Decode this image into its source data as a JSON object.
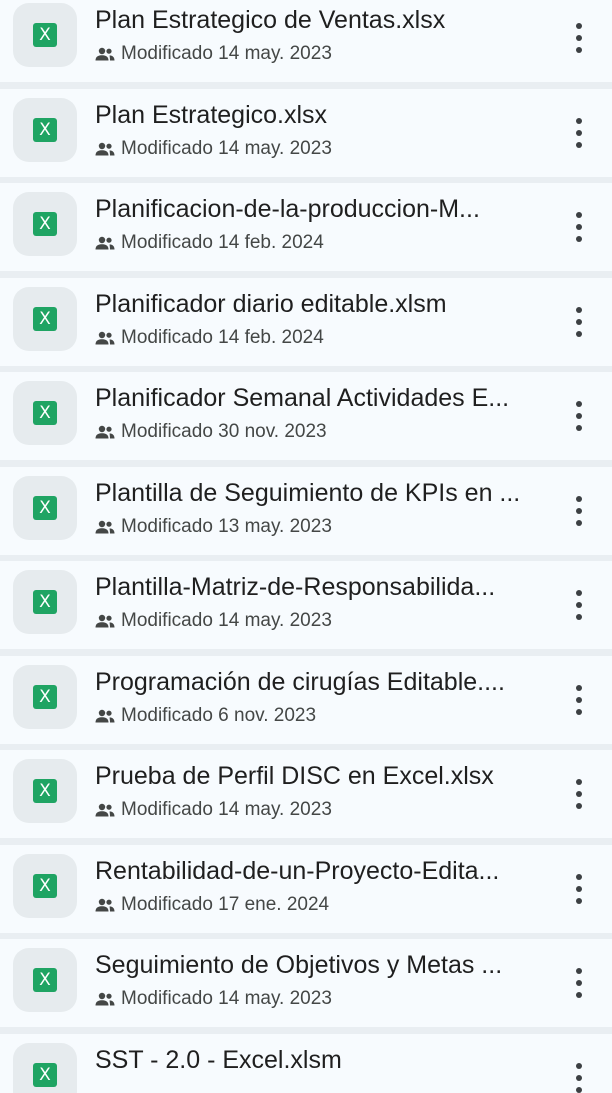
{
  "files": [
    {
      "name": "Plan Estrategico de Ventas.xlsx",
      "meta": "Modificado 14 may. 2023",
      "file_icon": "excel-icon",
      "file_icon_letter": "X",
      "shared_icon": "people-icon",
      "more_icon": "more-vert-icon"
    },
    {
      "name": "Plan Estrategico.xlsx",
      "meta": "Modificado 14 may. 2023",
      "file_icon": "excel-icon",
      "file_icon_letter": "X",
      "shared_icon": "people-icon",
      "more_icon": "more-vert-icon"
    },
    {
      "name": "Planificacion-de-la-produccion-M...",
      "meta": "Modificado 14 feb. 2024",
      "file_icon": "excel-icon",
      "file_icon_letter": "X",
      "shared_icon": "people-icon",
      "more_icon": "more-vert-icon"
    },
    {
      "name": "Planificador diario editable.xlsm",
      "meta": "Modificado 14 feb. 2024",
      "file_icon": "excel-icon",
      "file_icon_letter": "X",
      "shared_icon": "people-icon",
      "more_icon": "more-vert-icon"
    },
    {
      "name": "Planificador Semanal Actividades E...",
      "meta": "Modificado 30 nov. 2023",
      "file_icon": "excel-icon",
      "file_icon_letter": "X",
      "shared_icon": "people-icon",
      "more_icon": "more-vert-icon"
    },
    {
      "name": "Plantilla de Seguimiento de KPIs en ...",
      "meta": "Modificado 13 may. 2023",
      "file_icon": "excel-icon",
      "file_icon_letter": "X",
      "shared_icon": "people-icon",
      "more_icon": "more-vert-icon"
    },
    {
      "name": "Plantilla-Matriz-de-Responsabilida...",
      "meta": "Modificado 14 may. 2023",
      "file_icon": "excel-icon",
      "file_icon_letter": "X",
      "shared_icon": "people-icon",
      "more_icon": "more-vert-icon"
    },
    {
      "name": "Programación de cirugías Editable....",
      "meta": "Modificado 6 nov. 2023",
      "file_icon": "excel-icon",
      "file_icon_letter": "X",
      "shared_icon": "people-icon",
      "more_icon": "more-vert-icon"
    },
    {
      "name": "Prueba de Perfil DISC en Excel.xlsx",
      "meta": "Modificado 14 may. 2023",
      "file_icon": "excel-icon",
      "file_icon_letter": "X",
      "shared_icon": "people-icon",
      "more_icon": "more-vert-icon"
    },
    {
      "name": "Rentabilidad-de-un-Proyecto-Edita...",
      "meta": "Modificado 17 ene. 2024",
      "file_icon": "excel-icon",
      "file_icon_letter": "X",
      "shared_icon": "people-icon",
      "more_icon": "more-vert-icon"
    },
    {
      "name": "Seguimiento de Objetivos y Metas ...",
      "meta": "Modificado 14 may. 2023",
      "file_icon": "excel-icon",
      "file_icon_letter": "X",
      "shared_icon": "people-icon",
      "more_icon": "more-vert-icon"
    },
    {
      "name": "SST - 2.0 - Excel.xlsm",
      "meta": "",
      "file_icon": "excel-icon",
      "file_icon_letter": "X",
      "shared_icon": "",
      "more_icon": "more-vert-icon"
    }
  ],
  "colors": {
    "row_background": "#f7fbfe",
    "divider": "#e9eef2",
    "thumbnail_background": "#e6ebee",
    "excel_green": "#1fa463",
    "title_text": "#1f1f1f",
    "meta_text": "#444746",
    "icon": "#3c4043"
  }
}
